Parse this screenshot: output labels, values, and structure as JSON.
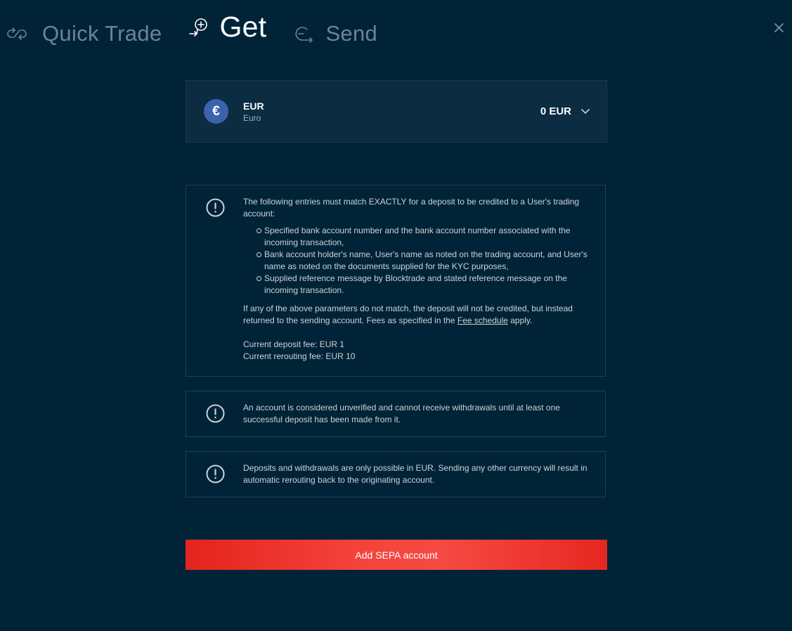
{
  "tabs": [
    {
      "label": "Quick Trade",
      "icon": "swap-icon",
      "active": false
    },
    {
      "label": "Get",
      "icon": "deposit-icon",
      "active": true
    },
    {
      "label": "Send",
      "icon": "send-icon",
      "active": false
    }
  ],
  "close_icon": "close-icon",
  "currency": {
    "symbol": "€",
    "code": "EUR",
    "name": "Euro",
    "balance": "0 EUR",
    "badge_color": "#3b63ad"
  },
  "notices": [
    {
      "intro": "The following entries must match EXACTLY for a deposit to be credited to a User's trading account:",
      "items": [
        "Specified bank account number and the bank account number associated with the incoming transaction,",
        "Bank account holder's name, User's name as noted on the trading account, and User's name as noted on the documents supplied for the KYC purposes,",
        "Supplied reference message by Blocktrade and stated reference message on the incoming transaction."
      ],
      "outro_before_link": "If any of the above parameters do not match, the deposit will not be credited, but instead returned to the sending account. Fees as specified in the ",
      "link_text": "Fee schedule",
      "outro_after_link": " apply.",
      "deposit_fee": "Current deposit fee: EUR 1",
      "rerouting_fee": "Current rerouting fee: EUR 10"
    },
    {
      "text": "An account is considered unverified and cannot receive withdrawals until at least one successful deposit has been made from it."
    },
    {
      "text": "Deposits and withdrawals are only possible in EUR. Sending any other currency will result in automatic rerouting back to the originating account."
    }
  ],
  "action_button": "Add SEPA account",
  "colors": {
    "background": "#012337",
    "card": "#0b2c41",
    "button_red": "#f3423a"
  }
}
